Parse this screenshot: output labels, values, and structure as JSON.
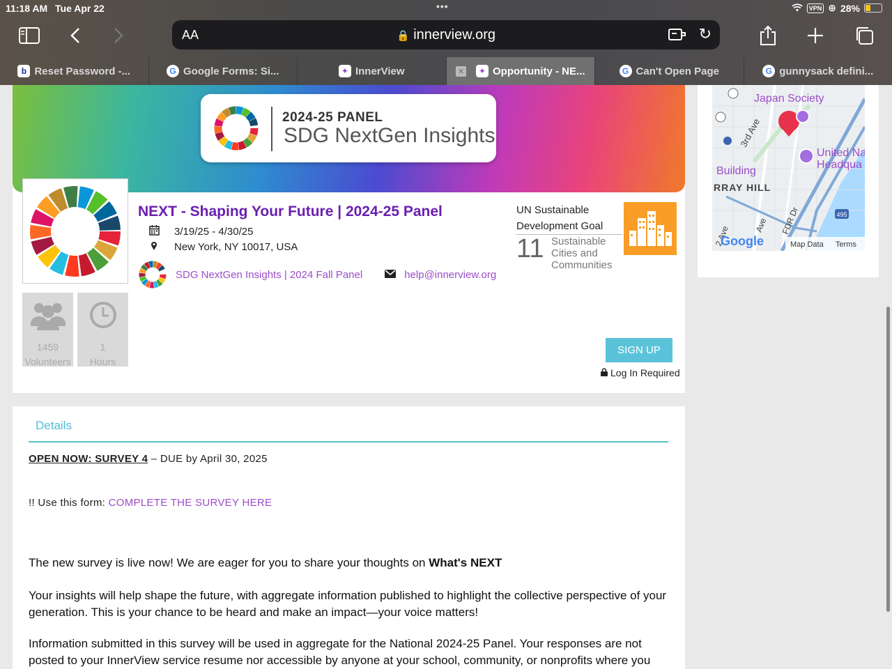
{
  "status": {
    "time": "11:18 AM",
    "date": "Tue Apr 22",
    "vpn": "VPN",
    "battery": "28%"
  },
  "browser": {
    "address_aa": "AA",
    "url": "innerview.org",
    "tabs": [
      {
        "label": "Reset Password -...",
        "icon": "b"
      },
      {
        "label": "Google Forms: Si...",
        "icon": "G"
      },
      {
        "label": "InnerView",
        "icon": "iv"
      },
      {
        "label": "Opportunity - NE...",
        "icon": "iv"
      },
      {
        "label": "Can't Open Page",
        "icon": "G"
      },
      {
        "label": "gunnysack defini...",
        "icon": "G"
      }
    ]
  },
  "banner": {
    "line1": "2024-25 PANEL",
    "line2": "SDG NextGen Insights"
  },
  "opportunity": {
    "title": "NEXT - Shaping Your Future | 2024-25 Panel",
    "dates": "3/19/25 - 4/30/25",
    "location": "New York, NY 10017, USA",
    "org": "SDG NextGen Insights | 2024 Fall Panel",
    "email": "help@innerview.org"
  },
  "goal": {
    "label": "UN Sustainable Development Goal",
    "number": "11",
    "name": "Sustainable Cities and Communities",
    "tile_color": "#f99d26"
  },
  "stats": [
    {
      "value": "1459",
      "label": "Volunteers",
      "icon": "users-icon"
    },
    {
      "value": "1",
      "label": "Hours",
      "icon": "clock-icon"
    }
  ],
  "signup_label": "SIGN UP",
  "login_required": "Log In Required",
  "map": {
    "labels": {
      "poi1": "Japan Society",
      "poi2": "United Na",
      "poi2b": "Headqua",
      "street1": "3rd Ave",
      "building": "Building",
      "hill": "RRAY HILL",
      "fdr": "FDR Dr",
      "ave2": "2 Ave",
      "ave3": "Ave",
      "shield": "495"
    },
    "google": "Google",
    "map_data": "Map Data",
    "terms": "Terms"
  },
  "details": {
    "tab": "Details",
    "open_now": "OPEN NOW: SURVEY 4",
    "due": " – DUE by April 30, 2025",
    "form_prefix": "!! Use this form: ",
    "form_link": "COMPLETE THE SURVEY HERE",
    "p1_start": "The new survey is live now! We are eager for you to share your thoughts on ",
    "p1_bold": "What's NEXT",
    "p2": "Your insights will help shape the future, with aggregate information published to highlight the collective perspective of your generation. This is your chance to be heard and make an impact—your voice matters!",
    "p3": "Information submitted in this survey will be used in aggregate for the National 2024-25 Panel.  Your responses are not posted to your InnerView service resume nor accessible by anyone at your school, community, or nonprofits where you"
  },
  "colors": {
    "accent_purple": "#6a1fb0",
    "link_purple": "#9b4dca",
    "teal": "#5bc3d9"
  }
}
